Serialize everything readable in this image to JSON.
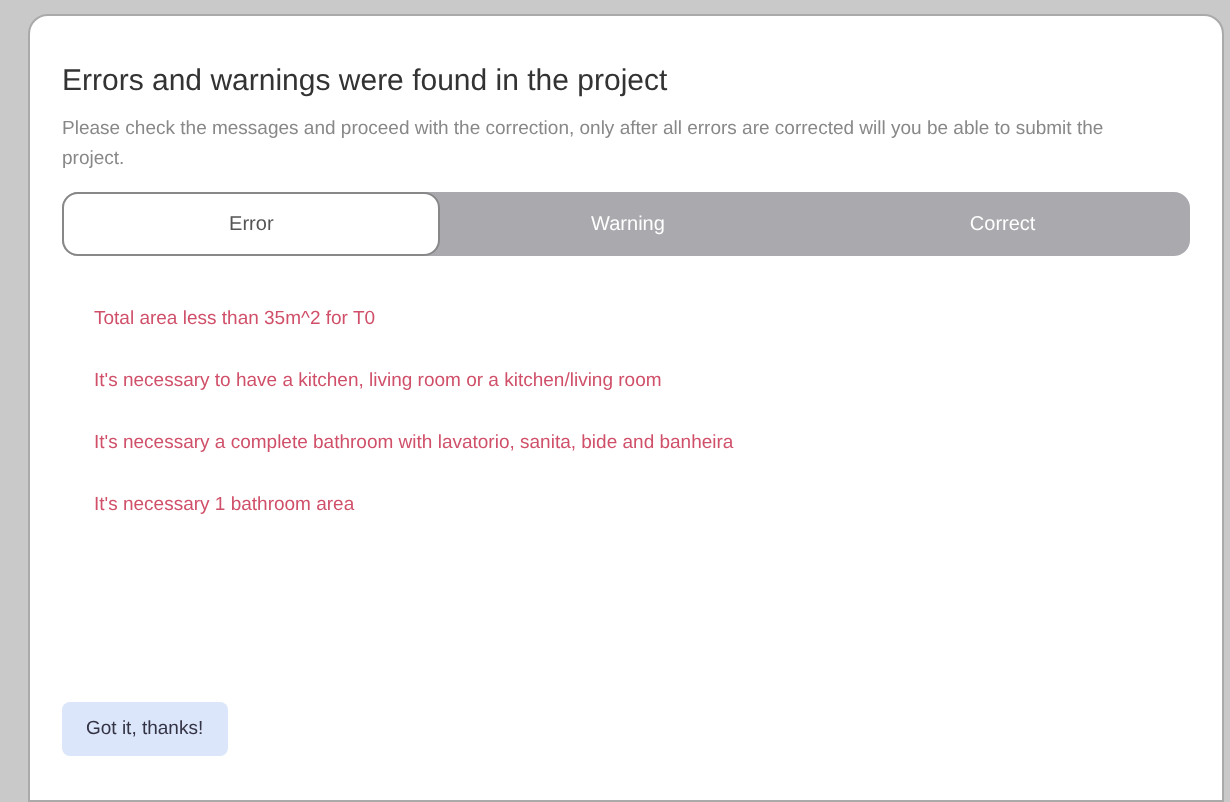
{
  "dialog": {
    "title": "Errors and warnings were found in the project",
    "description": "Please check the messages and proceed with the correction, only after all errors are corrected will you be able to submit the project."
  },
  "tabs": [
    {
      "label": "Error",
      "selected": true
    },
    {
      "label": "Warning",
      "selected": false
    },
    {
      "label": "Correct",
      "selected": false
    }
  ],
  "messages": [
    "Total area less than 35m^2 for T0",
    "It's necessary to have a kitchen, living room or a kitchen/living room",
    "It's necessary a complete bathroom with lavatorio, sanita, bide and banheira",
    "It's necessary 1 bathroom area"
  ],
  "button": "Got it, thanks!"
}
